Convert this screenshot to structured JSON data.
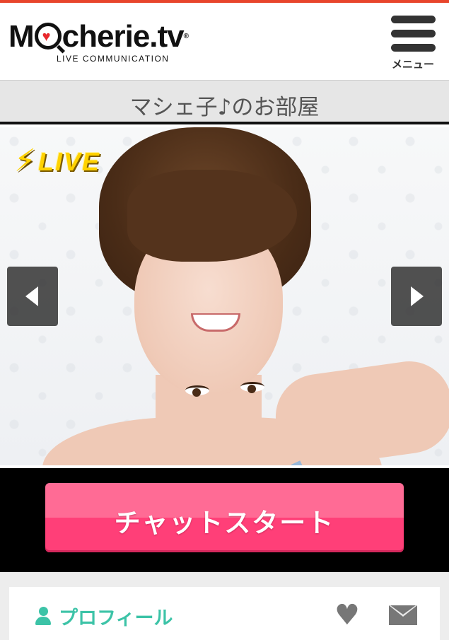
{
  "header": {
    "logo_text": "M",
    "logo_text_rest": "cherie.tv",
    "logo_reg": "®",
    "logo_subtitle": "LIVE COMMUNICATION",
    "menu_label": "メニュー"
  },
  "room": {
    "title": "マシェ子♪のお部屋"
  },
  "hero": {
    "live_badge": "LIVE",
    "status_color": "#ffd200"
  },
  "cta": {
    "chat_start_label": "チャットスタート",
    "color": "#ff4f84"
  },
  "profile": {
    "label": "プロフィール",
    "accent_color": "#3cc3a7",
    "icons": [
      "person-icon",
      "heart-icon",
      "mail-icon"
    ]
  }
}
